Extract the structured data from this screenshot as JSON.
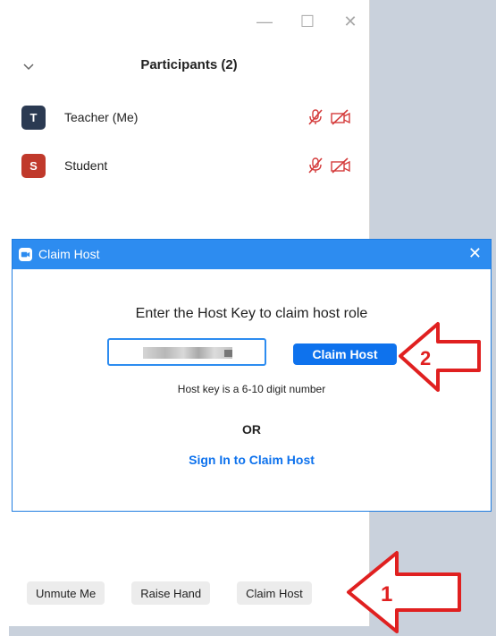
{
  "participants_panel": {
    "title": "Participants (2)",
    "items": [
      {
        "initial": "T",
        "name": "Teacher (Me)",
        "avatar_color": "#2b3a52"
      },
      {
        "initial": "S",
        "name": "Student",
        "avatar_color": "#c0392b"
      }
    ],
    "bottom_buttons": {
      "unmute": "Unmute Me",
      "raise_hand": "Raise Hand",
      "claim_host": "Claim Host"
    },
    "muted_icon": "microphone-muted-icon",
    "video_off_icon": "video-off-icon"
  },
  "dialog": {
    "title": "Claim Host",
    "heading": "Enter the Host Key to claim host role",
    "claim_button": "Claim Host",
    "hint": "Host key is a 6-10 digit number",
    "or": "OR",
    "signin": "Sign In to Claim Host"
  },
  "annotations": {
    "arrow1_label": "1",
    "arrow2_label": "2",
    "color": "#e02020"
  },
  "colors": {
    "accent": "#0e72ed",
    "titlebar": "#2d8cf0"
  }
}
